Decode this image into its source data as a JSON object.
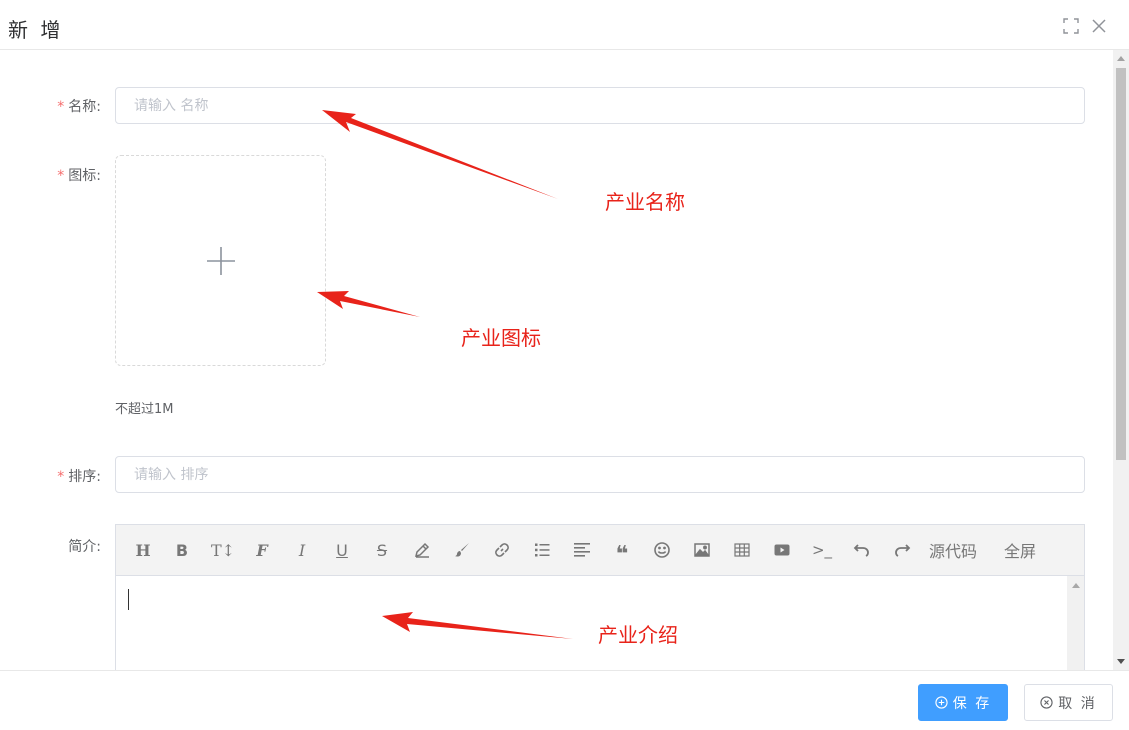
{
  "dialog": {
    "title": "新 增"
  },
  "form": {
    "name": {
      "label": "名称:",
      "required_mark": "*",
      "placeholder": "请输入 名称",
      "value": ""
    },
    "icon": {
      "label": "图标:",
      "required_mark": "*",
      "tip": "不超过1M"
    },
    "sort": {
      "label": "排序:",
      "required_mark": "*",
      "placeholder": "请输入 排序",
      "value": ""
    },
    "intro": {
      "label": "简介:",
      "toolbar": [
        {
          "name": "heading",
          "glyph": "H"
        },
        {
          "name": "bold",
          "glyph": "B"
        },
        {
          "name": "font-size",
          "glyph": "T↕"
        },
        {
          "name": "font-family",
          "glyph": "F"
        },
        {
          "name": "italic",
          "glyph": "I"
        },
        {
          "name": "underline",
          "glyph": "U"
        },
        {
          "name": "strikethrough",
          "glyph": "S"
        },
        {
          "name": "text-color",
          "glyph": "pencil"
        },
        {
          "name": "background-color",
          "glyph": "brush"
        },
        {
          "name": "link",
          "glyph": "link"
        },
        {
          "name": "list",
          "glyph": "list"
        },
        {
          "name": "justify",
          "glyph": "align"
        },
        {
          "name": "quote",
          "glyph": "❝"
        },
        {
          "name": "emoticon",
          "glyph": "☺"
        },
        {
          "name": "image",
          "glyph": "image"
        },
        {
          "name": "table",
          "glyph": "table"
        },
        {
          "name": "video",
          "glyph": "video"
        },
        {
          "name": "code",
          "glyph": ">_"
        },
        {
          "name": "undo",
          "glyph": "undo"
        },
        {
          "name": "redo",
          "glyph": "redo"
        }
      ],
      "source_label": "源代码",
      "fullscreen_label": "全屏"
    }
  },
  "annotations": {
    "name": "产业名称",
    "icon": "产业图标",
    "intro": "产业介绍"
  },
  "footer": {
    "save_label": "保 存",
    "cancel_label": "取 消"
  },
  "colors": {
    "primary": "#409eff",
    "required": "#f56c6c",
    "annotation": "#e8231a"
  }
}
